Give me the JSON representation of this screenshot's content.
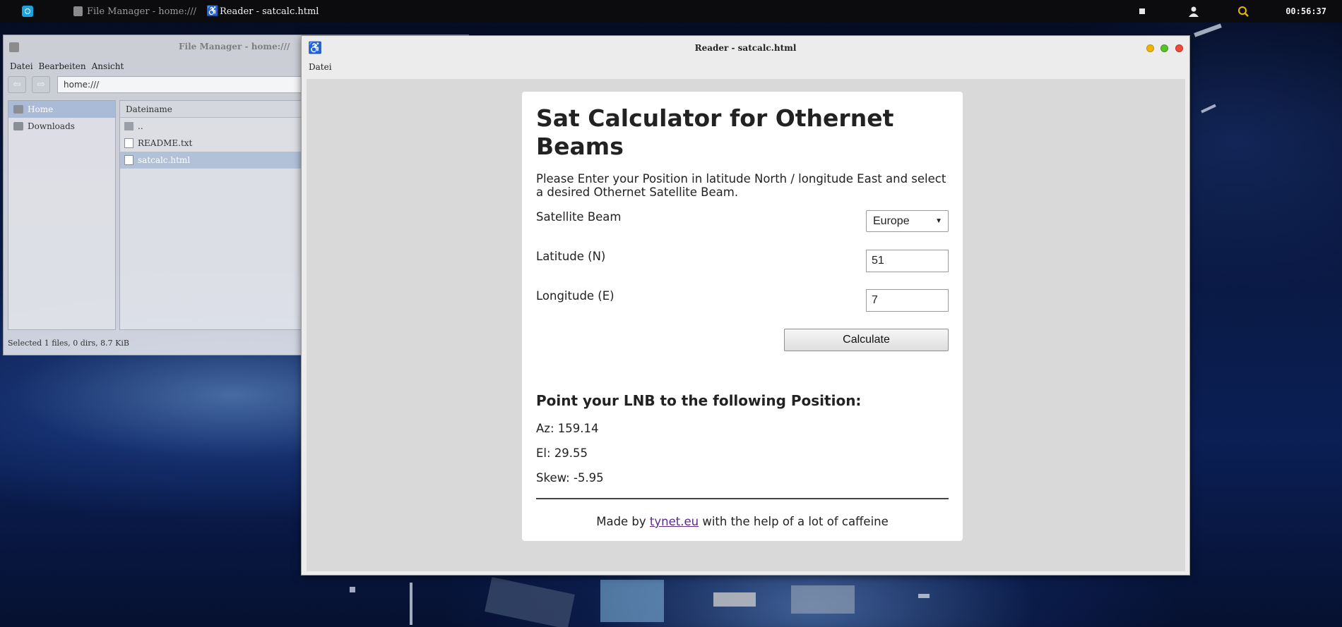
{
  "panel": {
    "tasks": [
      {
        "label": "File Manager - home:///"
      },
      {
        "label": "Reader - satcalc.html"
      }
    ],
    "clock": "00:56:37"
  },
  "file_manager": {
    "title": "File Manager - home:///",
    "menu": [
      "Datei",
      "Bearbeiten",
      "Ansicht"
    ],
    "address": "home:///",
    "sidebar": [
      "Home",
      "Downloads"
    ],
    "column_header": "Dateiname",
    "files": [
      "..",
      "README.txt",
      "satcalc.html"
    ],
    "status": "Selected 1 files, 0 dirs, 8.7 KiB"
  },
  "reader": {
    "title": "Reader - satcalc.html",
    "menu": [
      "Datei"
    ],
    "page": {
      "heading": "Sat Calculator for Othernet Beams",
      "intro": "Please Enter your Position in latitude North / longitude East and select a desired Othernet Satellite Beam.",
      "beam_label": "Satellite Beam",
      "beam_value": "Europe",
      "lat_label": "Latitude (N)",
      "lat_value": "51",
      "lon_label": "Longitude (E)",
      "lon_value": "7",
      "calculate_label": "Calculate",
      "result_heading": "Point your LNB to the following Position:",
      "az": "Az: 159.14",
      "el": "El: 29.55",
      "skew": "Skew: -5.95",
      "footer_prefix": "Made by ",
      "footer_link": "tynet.eu",
      "footer_suffix": " with the help of a lot of caffeine"
    }
  }
}
